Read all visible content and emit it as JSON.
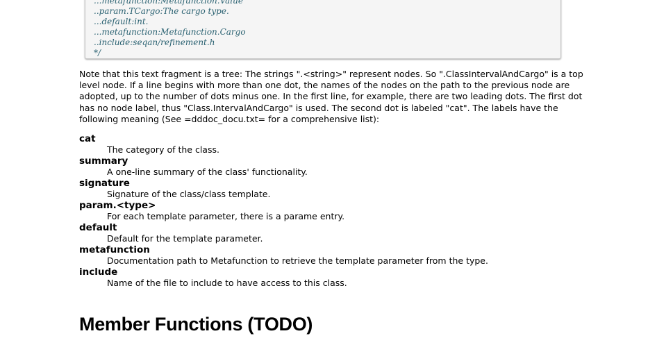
{
  "code_block": {
    "lines": [
      "...metafunction:Metafunction.Value",
      "..param.TCargo:The cargo type.",
      "...default:int.",
      "...metafunction:Metafunction.Cargo",
      "..include:seqan/refinement.h",
      "*/"
    ]
  },
  "paragraph": "Note that this text fragment is a tree: The strings \".<string>\" represent nodes. So \".ClassIntervalAndCargo\" is a top level node. If a line begins with more than one dot, the names of the nodes on the path to the previous node are adopted, up to the number of dots minus one. In the first line, for example, there are two leading dots. The first dot has no node label, thus \"Class.IntervalAndCargo\" is used. The second dot is labeled \"cat\". The labels have the following meaning (See =dddoc_docu.txt= for a comprehensive list):",
  "definitions": [
    {
      "term": "cat",
      "desc": "The category of the class."
    },
    {
      "term": "summary",
      "desc": "A one-line summary of the class' functionality."
    },
    {
      "term": "signature",
      "desc": "Signature of the class/class template."
    },
    {
      "term": "param.<type>",
      "desc": "For each template parameter, there is a parame entry."
    },
    {
      "term": "default",
      "desc": "Default for the template parameter."
    },
    {
      "term": "metafunction",
      "desc": "Documentation path to Metafunction to retrieve the template parameter from the type."
    },
    {
      "term": "include",
      "desc": "Name of the file to include to have access to this class."
    }
  ],
  "heading": "Member Functions (TODO)"
}
